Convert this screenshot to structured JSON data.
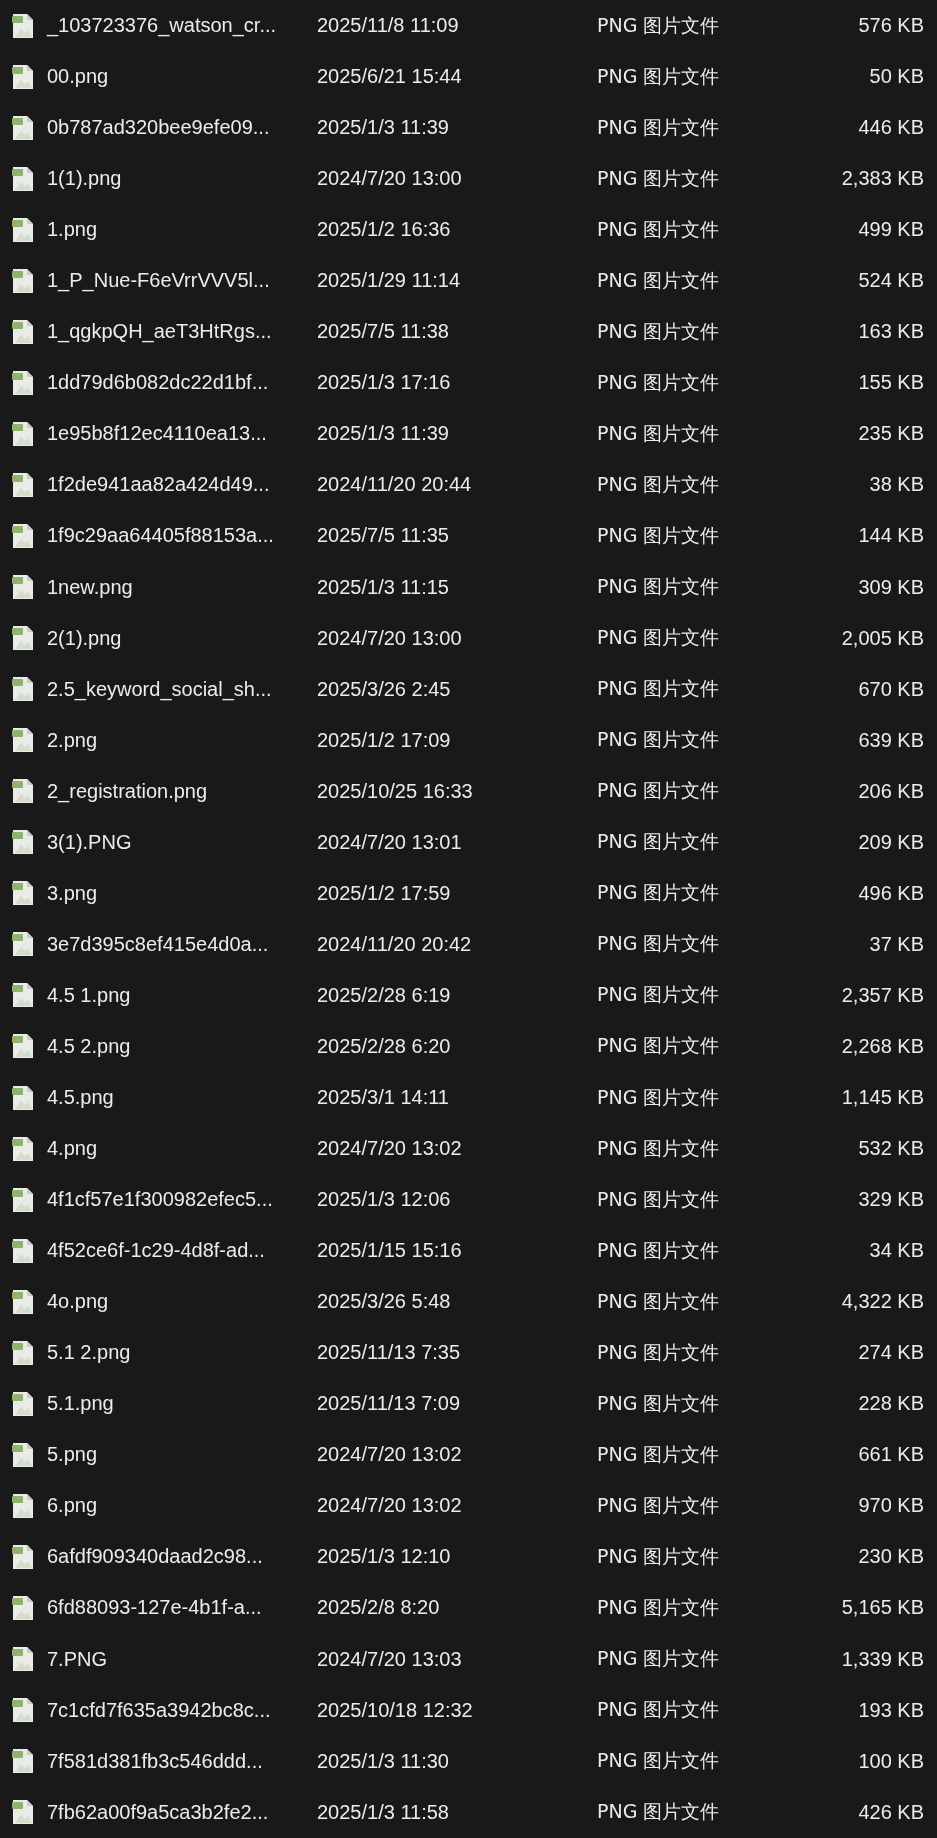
{
  "files": [
    {
      "name": "_103723376_watson_cr...",
      "modified": "2025/11/8 11:09",
      "type": "PNG 图片文件",
      "size": "576 KB"
    },
    {
      "name": "00.png",
      "modified": "2025/6/21 15:44",
      "type": "PNG 图片文件",
      "size": "50 KB"
    },
    {
      "name": "0b787ad320bee9efe09...",
      "modified": "2025/1/3 11:39",
      "type": "PNG 图片文件",
      "size": "446 KB"
    },
    {
      "name": "1(1).png",
      "modified": "2024/7/20 13:00",
      "type": "PNG 图片文件",
      "size": "2,383 KB"
    },
    {
      "name": "1.png",
      "modified": "2025/1/2 16:36",
      "type": "PNG 图片文件",
      "size": "499 KB"
    },
    {
      "name": "1_P_Nue-F6eVrrVVV5l...",
      "modified": "2025/1/29 11:14",
      "type": "PNG 图片文件",
      "size": "524 KB"
    },
    {
      "name": "1_qgkpQH_aeT3HtRgs...",
      "modified": "2025/7/5 11:38",
      "type": "PNG 图片文件",
      "size": "163 KB"
    },
    {
      "name": "1dd79d6b082dc22d1bf...",
      "modified": "2025/1/3 17:16",
      "type": "PNG 图片文件",
      "size": "155 KB"
    },
    {
      "name": "1e95b8f12ec4110ea13...",
      "modified": "2025/1/3 11:39",
      "type": "PNG 图片文件",
      "size": "235 KB"
    },
    {
      "name": "1f2de941aa82a424d49...",
      "modified": "2024/11/20 20:44",
      "type": "PNG 图片文件",
      "size": "38 KB"
    },
    {
      "name": "1f9c29aa64405f88153a...",
      "modified": "2025/7/5 11:35",
      "type": "PNG 图片文件",
      "size": "144 KB"
    },
    {
      "name": "1new.png",
      "modified": "2025/1/3 11:15",
      "type": "PNG 图片文件",
      "size": "309 KB"
    },
    {
      "name": "2(1).png",
      "modified": "2024/7/20 13:00",
      "type": "PNG 图片文件",
      "size": "2,005 KB"
    },
    {
      "name": "2.5_keyword_social_sh...",
      "modified": "2025/3/26 2:45",
      "type": "PNG 图片文件",
      "size": "670 KB"
    },
    {
      "name": "2.png",
      "modified": "2025/1/2 17:09",
      "type": "PNG 图片文件",
      "size": "639 KB"
    },
    {
      "name": "2_registration.png",
      "modified": "2025/10/25 16:33",
      "type": "PNG 图片文件",
      "size": "206 KB"
    },
    {
      "name": "3(1).PNG",
      "modified": "2024/7/20 13:01",
      "type": "PNG 图片文件",
      "size": "209 KB"
    },
    {
      "name": "3.png",
      "modified": "2025/1/2 17:59",
      "type": "PNG 图片文件",
      "size": "496 KB"
    },
    {
      "name": "3e7d395c8ef415e4d0a...",
      "modified": "2024/11/20 20:42",
      "type": "PNG 图片文件",
      "size": "37 KB"
    },
    {
      "name": "4.5 1.png",
      "modified": "2025/2/28 6:19",
      "type": "PNG 图片文件",
      "size": "2,357 KB"
    },
    {
      "name": "4.5 2.png",
      "modified": "2025/2/28 6:20",
      "type": "PNG 图片文件",
      "size": "2,268 KB"
    },
    {
      "name": "4.5.png",
      "modified": "2025/3/1 14:11",
      "type": "PNG 图片文件",
      "size": "1,145 KB"
    },
    {
      "name": "4.png",
      "modified": "2024/7/20 13:02",
      "type": "PNG 图片文件",
      "size": "532 KB"
    },
    {
      "name": "4f1cf57e1f300982efec5...",
      "modified": "2025/1/3 12:06",
      "type": "PNG 图片文件",
      "size": "329 KB"
    },
    {
      "name": "4f52ce6f-1c29-4d8f-ad...",
      "modified": "2025/1/15 15:16",
      "type": "PNG 图片文件",
      "size": "34 KB"
    },
    {
      "name": "4o.png",
      "modified": "2025/3/26 5:48",
      "type": "PNG 图片文件",
      "size": "4,322 KB"
    },
    {
      "name": "5.1 2.png",
      "modified": "2025/11/13 7:35",
      "type": "PNG 图片文件",
      "size": "274 KB"
    },
    {
      "name": "5.1.png",
      "modified": "2025/11/13 7:09",
      "type": "PNG 图片文件",
      "size": "228 KB"
    },
    {
      "name": "5.png",
      "modified": "2024/7/20 13:02",
      "type": "PNG 图片文件",
      "size": "661 KB"
    },
    {
      "name": "6.png",
      "modified": "2024/7/20 13:02",
      "type": "PNG 图片文件",
      "size": "970 KB"
    },
    {
      "name": "6afdf909340daad2c98...",
      "modified": "2025/1/3 12:10",
      "type": "PNG 图片文件",
      "size": "230 KB"
    },
    {
      "name": "6fd88093-127e-4b1f-a...",
      "modified": "2025/2/8 8:20",
      "type": "PNG 图片文件",
      "size": "5,165 KB"
    },
    {
      "name": "7.PNG",
      "modified": "2024/7/20 13:03",
      "type": "PNG 图片文件",
      "size": "1,339 KB"
    },
    {
      "name": "7c1cfd7f635a3942bc8c...",
      "modified": "2025/10/18 12:32",
      "type": "PNG 图片文件",
      "size": "193 KB"
    },
    {
      "name": "7f581d381fb3c546ddd...",
      "modified": "2025/1/3 11:30",
      "type": "PNG 图片文件",
      "size": "100 KB"
    },
    {
      "name": "7fb62a00f9a5ca3b2fe2...",
      "modified": "2025/1/3 11:58",
      "type": "PNG 图片文件",
      "size": "426 KB"
    }
  ]
}
